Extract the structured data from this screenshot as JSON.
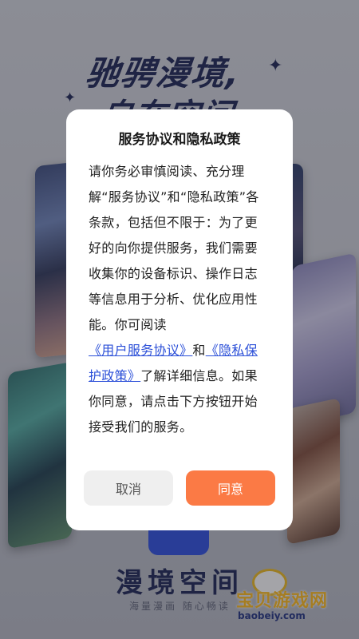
{
  "splash": {
    "slogan_line1": "驰骋漫境,",
    "slogan_line2": "自在空间",
    "sparkle_icon": "✦",
    "app_name": "漫境空间",
    "tagline": "海量漫画 随心畅读"
  },
  "watermark": {
    "brand": "宝贝游戏网",
    "url": "baobeiy.com"
  },
  "dialog": {
    "title": "服务协议和隐私政策",
    "body_prefix": "请你务必审慎阅读、充分理解“服务协议”和“隐私政策”各条款，包括但不限于：为了更好的向你提供服务，我们需要收集你的设备标识、操作日志等信息用于分析、优化应用性能。你可阅读",
    "link_user_agreement": "《用户服务协议》",
    "conjunction": "和",
    "link_privacy_policy": "《隐私保护政策》",
    "body_suffix": "了解详细信息。如果你同意，请点击下方按钮开始接受我们的服务。",
    "cancel_label": "取消",
    "agree_label": "同意"
  },
  "colors": {
    "accent": "#fb7a45",
    "link": "#2b4fd8",
    "brand_navy": "#1b2350"
  }
}
